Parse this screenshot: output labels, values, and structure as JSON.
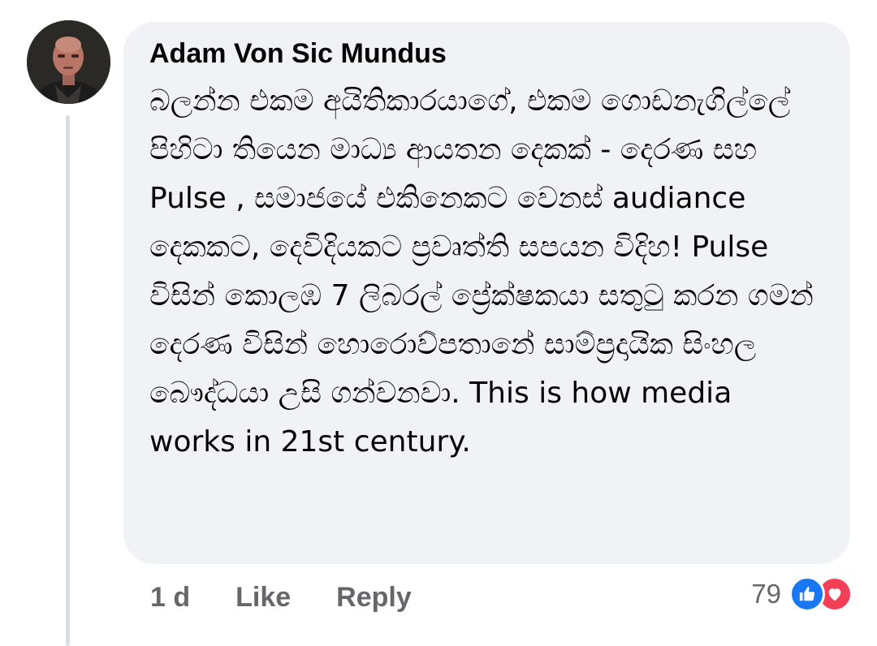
{
  "comment": {
    "author": "Adam Von Sic Mundus",
    "text": "බලන්න එකම අයිතිකාරයාගේ, එකම ගොඩනැගිල්ලේ පිහිටා තියෙන මාධ්‍ය ආයතන දෙකක් - දෙරණ සහ Pulse , සමාජයේ  එකිනෙකට වෙනස් audiance දෙකකට, දෙවිදියකට ප්‍රවෘත්ති සපයන විදිහ! Pulse විසින් කොලඹ 7 ලිබරල් ප්‍රේක්ෂකයා සතුටු කරන ගමන් දෙරණ විසින් හොරොව්පතානේ සාම්ප්‍රදායික සිංහල බෞද්ධයා උසි ගන්වනවා. This is how media works in 21st century."
  },
  "actions": {
    "time": "1 d",
    "like_label": "Like",
    "reply_label": "Reply"
  },
  "reactions": {
    "count": "79",
    "icons": [
      "thumbs-up-icon",
      "heart-icon"
    ],
    "like_color": "#1877f2",
    "love_color": "#f33e58"
  },
  "colors": {
    "bubble_bg": "#f0f2f5",
    "secondary_text": "#65676b",
    "thread_line": "#dadde1"
  }
}
